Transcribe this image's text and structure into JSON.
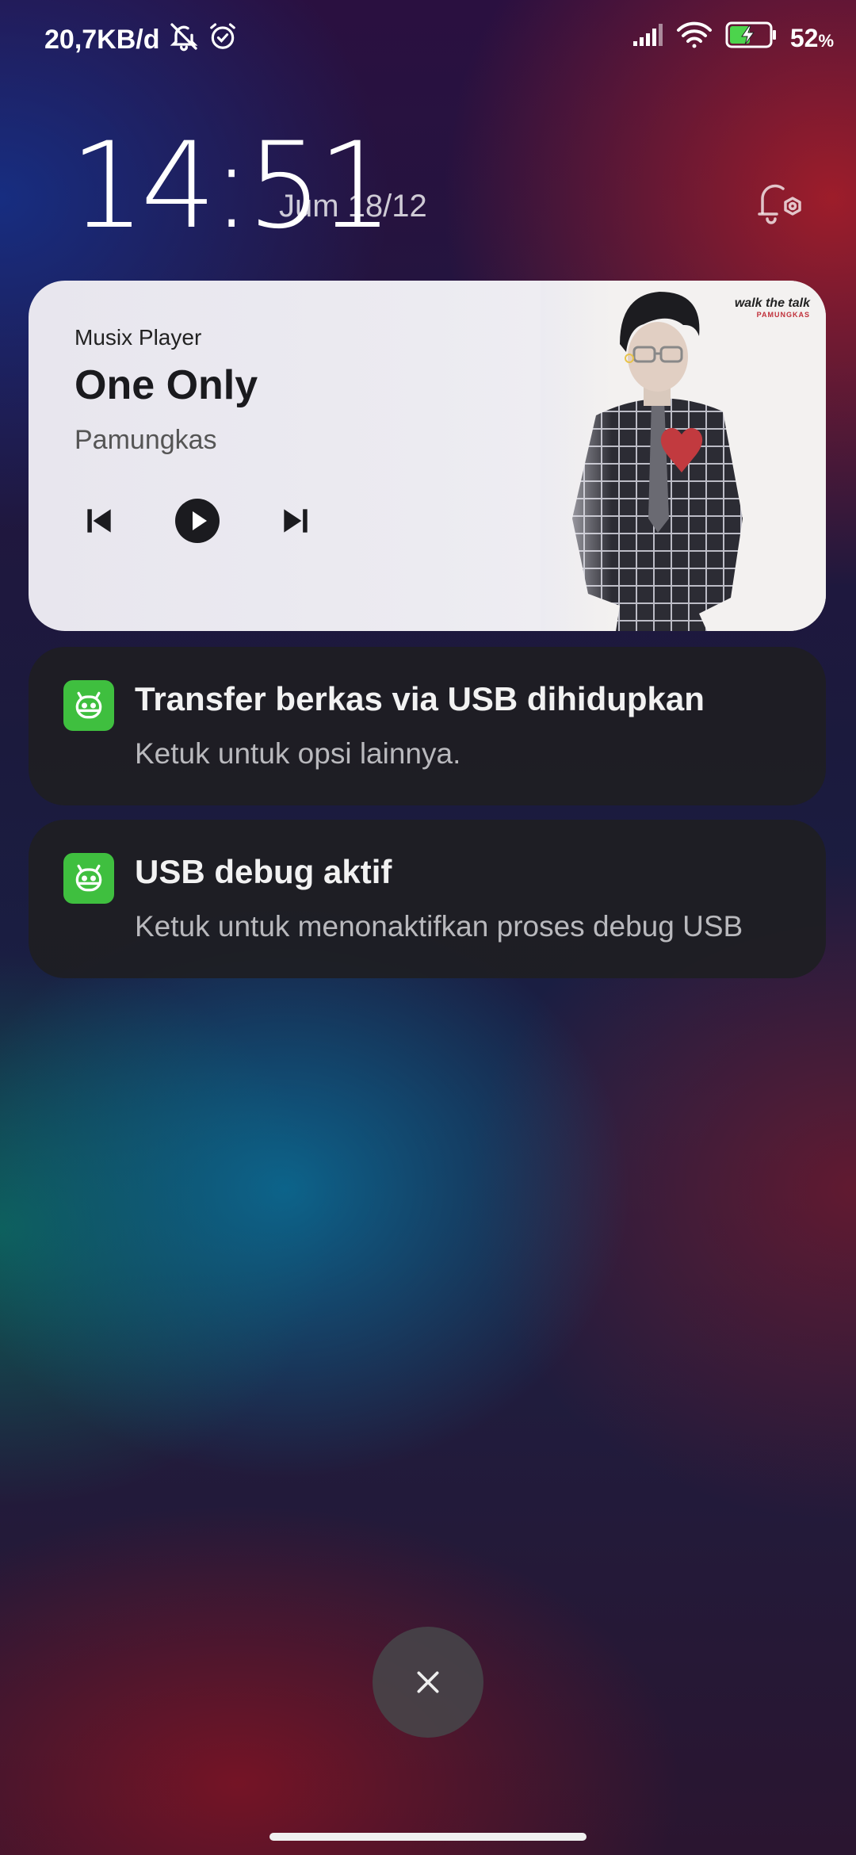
{
  "status_bar": {
    "net_speed": "20,7KB/d",
    "battery_percent": "52",
    "battery_pct_sign": "%",
    "battery_level": 0.52,
    "icons": [
      "mute-notifications-icon",
      "alarm-icon",
      "signal-icon",
      "wifi-icon",
      "battery-charging-icon"
    ]
  },
  "lockscreen": {
    "time": "14:51",
    "date": "Jum 18/12"
  },
  "media": {
    "app_name": "Musix Player",
    "title": "One Only",
    "artist": "Pamungkas",
    "album_text": "walk the talk",
    "album_artist_text": "PAMUNGKAS"
  },
  "notifications": [
    {
      "title": "Transfer berkas via USB dihidupkan",
      "body": "Ketuk untuk opsi lainnya.",
      "icon": "android-icon",
      "icon_color": "#3fbf3f"
    },
    {
      "title": "USB debug aktif",
      "body": "Ketuk untuk menonaktifkan proses debug USB",
      "icon": "android-icon",
      "icon_color": "#3fbf3f"
    }
  ]
}
